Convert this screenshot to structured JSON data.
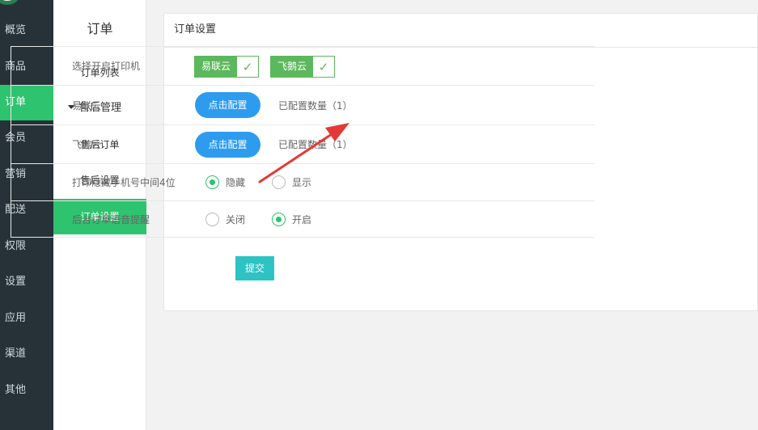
{
  "nav": {
    "items": [
      {
        "label": "概览"
      },
      {
        "label": "商品"
      },
      {
        "label": "订单"
      },
      {
        "label": "会员"
      },
      {
        "label": "营销"
      },
      {
        "label": "配送"
      },
      {
        "label": "权限"
      },
      {
        "label": "设置"
      },
      {
        "label": "应用"
      },
      {
        "label": "渠道"
      },
      {
        "label": "其他"
      }
    ],
    "active": "订单"
  },
  "subnav": {
    "title": "订单",
    "items": [
      {
        "label": "订单列表"
      },
      {
        "label": "售后管理"
      },
      {
        "label": "售后订单"
      },
      {
        "label": "售后设置"
      },
      {
        "label": "订单设置"
      }
    ],
    "active": "订单设置"
  },
  "panel": {
    "title": "订单设置"
  },
  "form": {
    "printer_label": "选择开启打印机",
    "printers": [
      {
        "label": "易联云",
        "checked": true
      },
      {
        "label": "飞鹅云",
        "checked": true
      }
    ],
    "rows": [
      {
        "label": "易联云",
        "button": "点击配置",
        "info": "已配置数量（1）"
      },
      {
        "label": "飞鹅云",
        "button": "点击配置",
        "info": "已配置数量（1）"
      }
    ],
    "hide_phone": {
      "label": "打印隐藏手机号中间4位",
      "options": [
        "隐藏",
        "显示"
      ],
      "selected": "隐藏"
    },
    "voice": {
      "label": "后台订单语音提醒",
      "options": [
        "关闭",
        "开启"
      ],
      "selected": "开启"
    },
    "submit": "提交"
  },
  "colors": {
    "sidebar_bg": "#263238",
    "active_green": "#2ec36e",
    "check_green": "#5cb85c",
    "config_blue": "#2d9cef",
    "submit_teal": "#2ec3c3",
    "annotation_arrow": "#e53935"
  }
}
